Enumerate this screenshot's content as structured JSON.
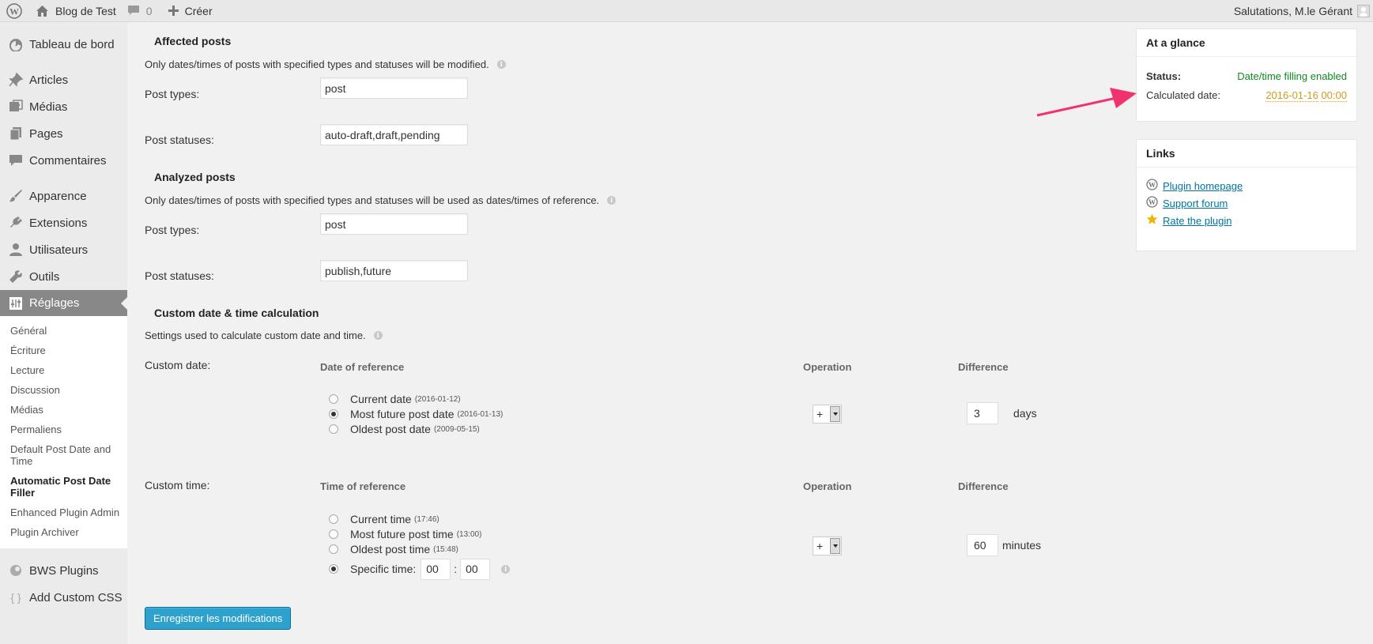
{
  "adminbar": {
    "site_name": "Blog de Test",
    "comments_count": "0",
    "create_label": "Créer",
    "greeting": "Salutations, M.le Gérant"
  },
  "sidebar": {
    "items": [
      {
        "label": "Tableau de bord",
        "icon": "dashboard-icon"
      },
      {
        "label": "Articles",
        "icon": "pin-icon"
      },
      {
        "label": "Médias",
        "icon": "media-icon"
      },
      {
        "label": "Pages",
        "icon": "pages-icon"
      },
      {
        "label": "Commentaires",
        "icon": "comments-icon"
      },
      {
        "label": "Apparence",
        "icon": "brush-icon"
      },
      {
        "label": "Extensions",
        "icon": "plugin-icon"
      },
      {
        "label": "Utilisateurs",
        "icon": "user-icon"
      },
      {
        "label": "Outils",
        "icon": "wrench-icon"
      },
      {
        "label": "Réglages",
        "icon": "settings-icon"
      }
    ],
    "submenu": [
      "Général",
      "Écriture",
      "Lecture",
      "Discussion",
      "Médias",
      "Permaliens",
      "Default Post Date and Time",
      "Automatic Post Date Filler",
      "Enhanced Plugin Admin",
      "Plugin Archiver"
    ],
    "bottom_items": [
      {
        "label": "BWS Plugins",
        "icon": "bws-icon"
      },
      {
        "label": "Add Custom CSS",
        "icon": "braces-icon"
      }
    ]
  },
  "affected": {
    "title": "Affected posts",
    "desc": "Only dates/times of posts with specified types and statuses will be modified.",
    "types_label": "Post types:",
    "types_value": "post",
    "statuses_label": "Post statuses:",
    "statuses_value": "auto-draft,draft,pending"
  },
  "analyzed": {
    "title": "Analyzed posts",
    "desc": "Only dates/times of posts with specified types and statuses will be used as dates/times of reference.",
    "types_label": "Post types:",
    "types_value": "post",
    "statuses_label": "Post statuses:",
    "statuses_value": "publish,future"
  },
  "custom": {
    "title": "Custom date & time calculation",
    "desc": "Settings used to calculate custom date and time.",
    "date": {
      "label": "Custom date:",
      "ref_head": "Date of reference",
      "op_head": "Operation",
      "diff_head": "Difference",
      "options": [
        {
          "label": "Current date",
          "note": "(2016-01-12)",
          "checked": false
        },
        {
          "label": "Most future post date",
          "note": "(2016-01-13)",
          "checked": true
        },
        {
          "label": "Oldest post date",
          "note": "(2009-05-15)",
          "checked": false
        }
      ],
      "operation": "+",
      "difference": "3",
      "unit": "days"
    },
    "time": {
      "label": "Custom time:",
      "ref_head": "Time of reference",
      "op_head": "Operation",
      "diff_head": "Difference",
      "options": [
        {
          "label": "Current time",
          "note": "(17:46)",
          "checked": false
        },
        {
          "label": "Most future post time",
          "note": "(13:00)",
          "checked": false
        },
        {
          "label": "Oldest post time",
          "note": "(15:48)",
          "checked": false
        },
        {
          "label": "Specific time:",
          "note": "",
          "checked": true
        }
      ],
      "specific_hour": "00",
      "specific_minute": "00",
      "separator": ":",
      "operation": "+",
      "difference": "60",
      "unit": "minutes"
    }
  },
  "save_label": "Enregistrer les modifications",
  "glance": {
    "title": "At a glance",
    "status_label": "Status:",
    "status_value": "Date/time filling enabled",
    "calc_label": "Calculated date:",
    "calc_date": "2016-01-16",
    "calc_time": "00:00"
  },
  "links": {
    "title": "Links",
    "items": [
      "Plugin homepage",
      "Support forum",
      "Rate the plugin"
    ]
  },
  "colors": {
    "status_green": "#0c8a20",
    "calc_orange": "#d39a1c",
    "arrow_pink": "#f0336e",
    "button_blue": "#2ea2cc"
  }
}
